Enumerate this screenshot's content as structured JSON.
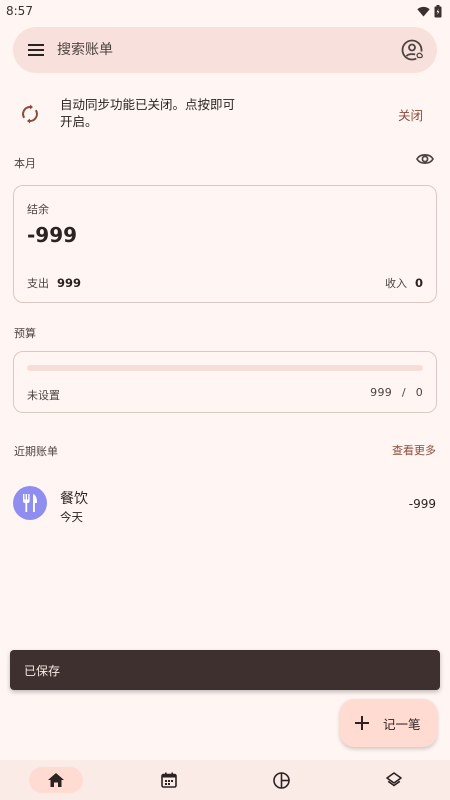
{
  "status_bar": {
    "time": "8:57"
  },
  "search": {
    "placeholder": "搜索账单"
  },
  "sync_banner": {
    "message": "自动同步功能已关闭。点按即可开启。",
    "close_label": "关闭"
  },
  "month_section": {
    "label": "本月"
  },
  "balance_card": {
    "balance_label": "结余",
    "balance_value": "-999",
    "expense_label": "支出",
    "expense_value": "999",
    "income_label": "收入",
    "income_value": "0"
  },
  "budget_section": {
    "label": "预算",
    "status": "未设置",
    "spent": "999",
    "separator": "/",
    "total": "0",
    "progress_fraction": 0
  },
  "recent_section": {
    "label": "近期账单",
    "see_more_label": "查看更多",
    "items": [
      {
        "category": "餐饮",
        "date": "今天",
        "amount": "-999",
        "icon": "restaurant-icon"
      }
    ]
  },
  "snackbar": {
    "message": "已保存"
  },
  "fab": {
    "label": "记一笔"
  },
  "bottom_nav": {
    "items": [
      {
        "icon": "home-icon",
        "active": true
      },
      {
        "icon": "calendar-icon",
        "active": false
      },
      {
        "icon": "chart-pie-icon",
        "active": false
      },
      {
        "icon": "layers-icon",
        "active": false
      }
    ]
  },
  "colors": {
    "background": "#fff6f3",
    "accent": "#8c4a3c",
    "search_bg": "#f8e1dc",
    "category_icon_bg": "#8f8ef0",
    "snackbar_bg": "#3d302e",
    "fab_bg": "#ffdbd2"
  }
}
